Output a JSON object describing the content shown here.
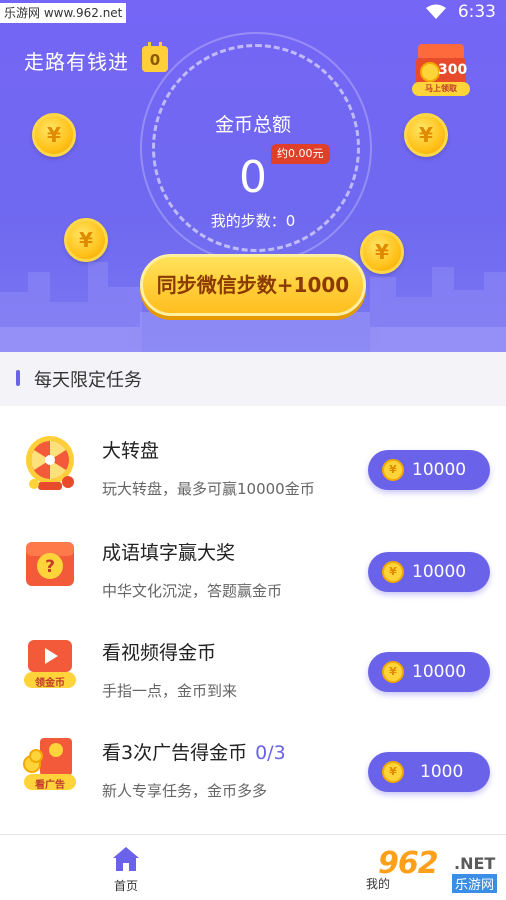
{
  "status_bar": {
    "watermark": "乐游网 www.962.net",
    "time": "6:33"
  },
  "header": {
    "app_title": "走路有钱进",
    "title_badge": "0",
    "gift": {
      "coins": "300",
      "ribbon": "马上领取"
    },
    "total_label": "金币总额",
    "yuan_badge": "约0.00元",
    "total_value": "0",
    "steps_line": "我的步数：0",
    "coin_symbol": "¥",
    "sync_button": "同步微信步数+1000"
  },
  "section": {
    "title": "每天限定任务"
  },
  "tasks": [
    {
      "title": "大转盘",
      "progress": "",
      "desc": "玩大转盘，最多可赢10000金币",
      "reward": "10000",
      "icon": "spin-wheel-icon"
    },
    {
      "title": "成语填字赢大奖",
      "progress": "",
      "desc": "中华文化沉淀，答题赢金币",
      "reward": "10000",
      "icon": "question-box-icon"
    },
    {
      "title": "看视频得金币",
      "progress": "",
      "desc": "手指一点，金币到来",
      "reward": "10000",
      "icon": "video-coin-icon",
      "icon_text": "领金币"
    },
    {
      "title": "看3次广告得金币",
      "progress": "0/3",
      "desc": "新人专享任务，金币多多",
      "reward": "1000",
      "icon": "ad-envelope-icon",
      "icon_text": "看广告"
    }
  ],
  "nav": {
    "home": "首页",
    "mine": "我的"
  },
  "watermark_logo": {
    "big": "962",
    "net": ".NET",
    "sub": "乐游网"
  },
  "colors": {
    "header": "#7566f6",
    "accent": "#6a62e8",
    "coin": "#ffd43b",
    "sync_button": "#ffc928"
  }
}
